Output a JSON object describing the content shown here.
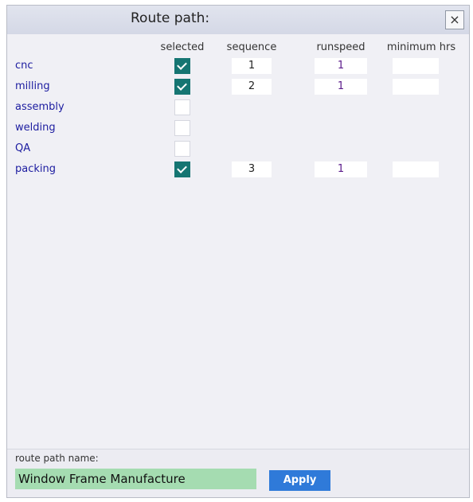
{
  "dialog": {
    "title": "Route path:",
    "close_glyph": "×"
  },
  "columns": {
    "selected": "selected",
    "sequence": "sequence",
    "runspeed": "runspeed",
    "minimum_hrs": "minimum hrs"
  },
  "rows": [
    {
      "label": "cnc",
      "selected": true,
      "sequence": "1",
      "runspeed": "1",
      "minimum_hrs": ""
    },
    {
      "label": "milling",
      "selected": true,
      "sequence": "2",
      "runspeed": "1",
      "minimum_hrs": ""
    },
    {
      "label": "assembly",
      "selected": false
    },
    {
      "label": "welding",
      "selected": false
    },
    {
      "label": "QA",
      "selected": false
    },
    {
      "label": "packing",
      "selected": true,
      "sequence": "3",
      "runspeed": "1",
      "minimum_hrs": ""
    }
  ],
  "footer": {
    "label": "route path name:",
    "value": "Window Frame Manufacture",
    "apply_label": "Apply"
  },
  "colors": {
    "checkbox_checked": "#157572",
    "input_highlight": "#a5dcb1",
    "apply_button": "#2f7ad9",
    "row_label_text": "#1c1ca0"
  }
}
